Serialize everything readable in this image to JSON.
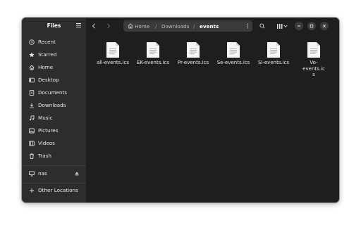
{
  "sidebar": {
    "title": "Files",
    "items": [
      {
        "label": "Recent",
        "icon": "clock-icon"
      },
      {
        "label": "Starred",
        "icon": "star-icon"
      },
      {
        "label": "Home",
        "icon": "home-icon"
      },
      {
        "label": "Desktop",
        "icon": "desktop-icon"
      },
      {
        "label": "Documents",
        "icon": "document-icon"
      },
      {
        "label": "Downloads",
        "icon": "download-icon"
      },
      {
        "label": "Music",
        "icon": "music-icon"
      },
      {
        "label": "Pictures",
        "icon": "picture-icon"
      },
      {
        "label": "Videos",
        "icon": "video-icon"
      },
      {
        "label": "Trash",
        "icon": "trash-icon"
      }
    ],
    "network": {
      "label": "nas",
      "icon": "computer-icon"
    },
    "other": {
      "label": "Other Locations",
      "icon": "plus-icon"
    }
  },
  "pathbar": {
    "home": "Home",
    "sep": "/",
    "downloads": "Downloads",
    "current": "events"
  },
  "files": [
    {
      "name": "all-events.ics"
    },
    {
      "name": "EK-events.ics"
    },
    {
      "name": "Pr-events.ics"
    },
    {
      "name": "Se-events.ics"
    },
    {
      "name": "SI-events.ics"
    },
    {
      "name": "Vo-events.ics"
    }
  ],
  "colors": {
    "sidebar_bg": "#2d2d2d",
    "main_bg": "#1e1e1e",
    "pathbar_bg": "#3a3a3a",
    "text": "#e6e6e6"
  }
}
